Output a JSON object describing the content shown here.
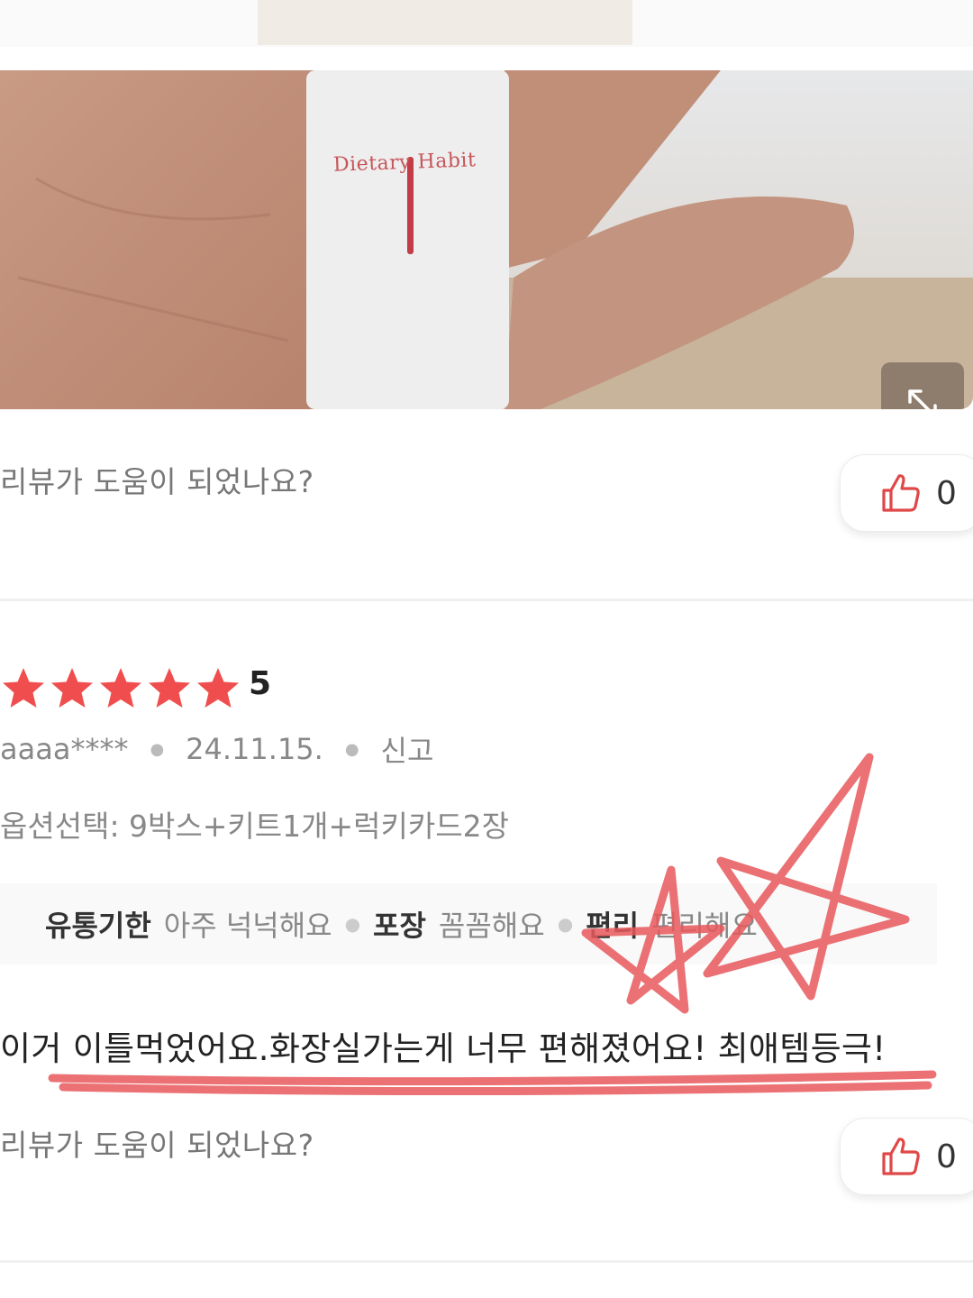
{
  "review_photo": {
    "brand_label": "Dietary Habit",
    "expand_icon": "expand-arrows-icon"
  },
  "helpful_prompt_1": {
    "question": "리뷰가 도움이 되었나요?",
    "icon": "thumbs-up-icon",
    "count": "0"
  },
  "review": {
    "rating": 5,
    "rating_text": "5",
    "star_color": "#f04e4e",
    "author": "aaaa****",
    "date": "24.11.15.",
    "report_label": "신고",
    "option": "옵션선택: 9박스+키트1개+럭키카드2장",
    "tags": [
      {
        "key": "유통기한",
        "value": "아주 넉넉해요"
      },
      {
        "key": "포장",
        "value": "꼼꼼해요"
      },
      {
        "key": "편리",
        "value": "편리해요"
      }
    ],
    "body": "이거 이틀먹었어요.화장실가는게 너무 편해졌어요! 최애템등극!"
  },
  "helpful_prompt_2": {
    "question": "리뷰가 도움이 되었나요?",
    "icon": "thumbs-up-icon",
    "count": "0"
  },
  "colors": {
    "accent": "#e04848",
    "annotation": "#e8585c"
  }
}
